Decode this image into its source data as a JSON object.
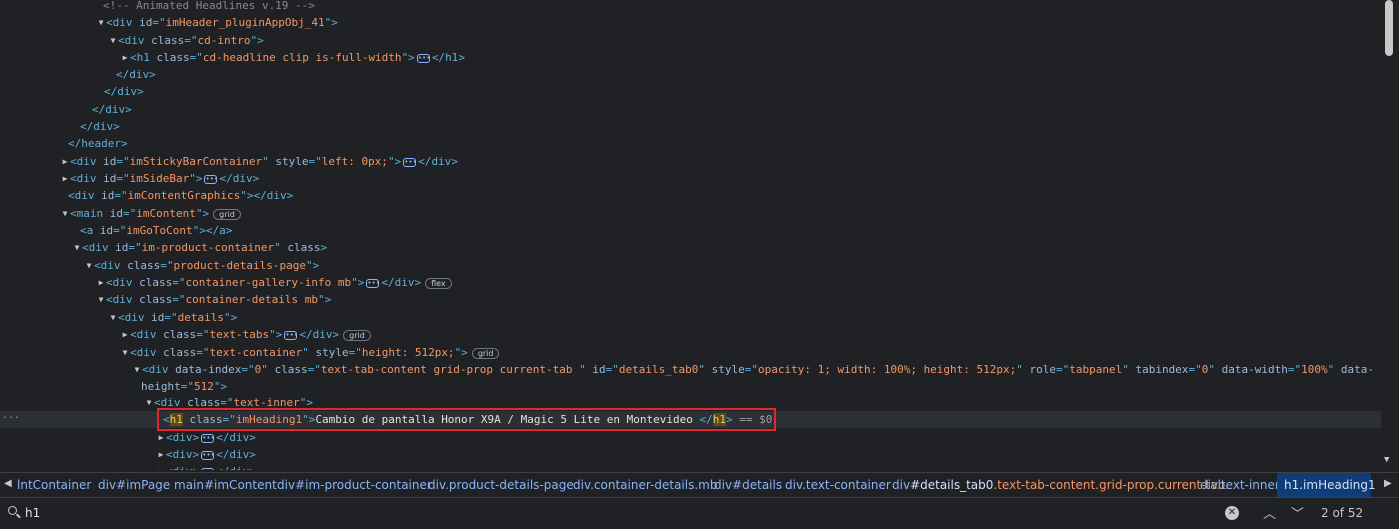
{
  "tree": {
    "l0": {
      "comment": "<!-- Animated Headlines v.19 -->"
    },
    "l1": {
      "tag": "div",
      "a1": "id",
      "v1": "imHeader_pluginAppObj_41"
    },
    "l2": {
      "tag": "div",
      "a1": "class",
      "v1": "cd-intro"
    },
    "l3": {
      "tag": "h1",
      "a1": "class",
      "v1": "cd-headline clip is-full-width",
      "close": "h1"
    },
    "l4": {
      "close": "div"
    },
    "l5": {
      "close": "div"
    },
    "l6": {
      "close": "div"
    },
    "l7": {
      "close": "div"
    },
    "l8": {
      "close": "header"
    },
    "l9": {
      "tag": "div",
      "a1": "id",
      "v1": "imStickyBarContainer",
      "a2": "style",
      "v2": "left: 0px;",
      "close": "div"
    },
    "l10": {
      "tag": "div",
      "a1": "id",
      "v1": "imSideBar",
      "close": "div"
    },
    "l11": {
      "tag": "div",
      "a1": "id",
      "v1": "imContentGraphics",
      "close": "div"
    },
    "l12": {
      "tag": "main",
      "a1": "id",
      "v1": "imContent",
      "badge": "grid"
    },
    "l13": {
      "tag": "a",
      "a1": "id",
      "v1": "imGoToCont",
      "close": "a"
    },
    "l14": {
      "tag": "div",
      "a1": "id",
      "v1": "im-product-container",
      "a2": "class"
    },
    "l15": {
      "tag": "div",
      "a1": "class",
      "v1": "product-details-page"
    },
    "l16": {
      "tag": "div",
      "a1": "class",
      "v1": "container-gallery-info mb",
      "close": "div",
      "badge": "flex"
    },
    "l17": {
      "tag": "div",
      "a1": "class",
      "v1": "container-details mb"
    },
    "l18": {
      "tag": "div",
      "a1": "id",
      "v1": "details"
    },
    "l19": {
      "tag": "div",
      "a1": "class",
      "v1": "text-tabs",
      "close": "div",
      "badge": "grid"
    },
    "l20": {
      "tag": "div",
      "a1": "class",
      "v1": "text-container",
      "a2": "style",
      "v2": "height: 512px;",
      "badge": "grid"
    },
    "l21": {
      "tag": "div",
      "a1": "data-index",
      "v1": "0",
      "a2": "class",
      "v2": "text-tab-content grid-prop current-tab ",
      "a3": "id",
      "v3": "details_tab0",
      "a4": "style",
      "v4": "opacity: 1; width: 100%; height: 512px;",
      "a5": "role",
      "v5": "tabpanel",
      "a6": "tabindex",
      "v6": "0",
      "a7": "data-width",
      "v7": "100%",
      "a8": "data-",
      "a8b": "height",
      "v8": "512"
    },
    "l22": {
      "tag": "div",
      "a1": "class",
      "v1": "text-inner"
    },
    "l23": {
      "tag": "h1",
      "a1": "class",
      "v1": "imHeading1",
      "text": "Cambio de pantalla Honor X9A / Magic 5 Lite en Montevideo ",
      "close": "h1",
      "eq": "== $0"
    },
    "l24": {
      "tag": "div",
      "close": "div"
    },
    "l25": {
      "tag": "div",
      "close": "div"
    },
    "l26": {
      "tag": "div",
      "close": "div"
    },
    "selected_dots": "..."
  },
  "breadcrumbs": {
    "c0": "lntContainer",
    "c1": "div#imPage",
    "c2": "main#imContent",
    "c3": "div#im-product-container",
    "c4": "div.product-details-page",
    "c5": "div.container-details.mb",
    "c6": "div#details",
    "c7": "div.text-container",
    "c8a": "div",
    "c8b": "#details_tab0",
    "c8c": ".text-tab-content.grid-prop.current-tab.",
    "c9": "div.text-inner",
    "c10": "h1.imHeading1"
  },
  "search": {
    "value": "h1",
    "count": "2 of 52",
    "up_icon": "chevron-up-icon",
    "down_icon": "chevron-down-icon"
  }
}
